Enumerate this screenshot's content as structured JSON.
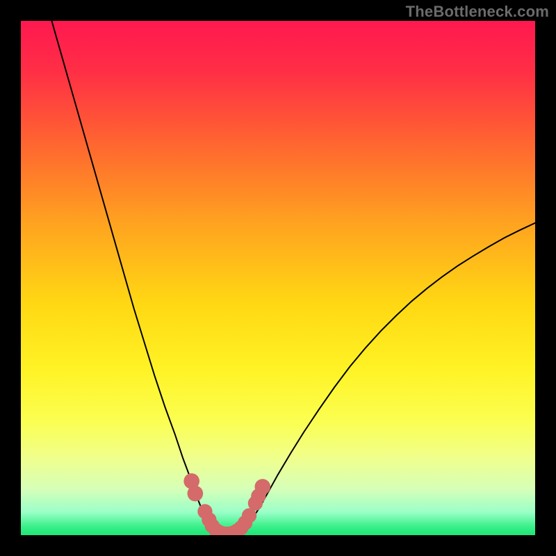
{
  "watermark": "TheBottleneck.com",
  "gradient": {
    "stops": [
      {
        "offset": 0.0,
        "color": "#ff1850"
      },
      {
        "offset": 0.1,
        "color": "#ff2f45"
      },
      {
        "offset": 0.25,
        "color": "#ff6a2f"
      },
      {
        "offset": 0.4,
        "color": "#ffa51f"
      },
      {
        "offset": 0.55,
        "color": "#ffd813"
      },
      {
        "offset": 0.68,
        "color": "#fff326"
      },
      {
        "offset": 0.78,
        "color": "#fbff52"
      },
      {
        "offset": 0.85,
        "color": "#f0ff8c"
      },
      {
        "offset": 0.91,
        "color": "#d6ffb8"
      },
      {
        "offset": 0.955,
        "color": "#9bffc8"
      },
      {
        "offset": 0.985,
        "color": "#35ef86"
      },
      {
        "offset": 1.0,
        "color": "#1fe676"
      }
    ]
  },
  "chart_data": {
    "type": "line",
    "title": "",
    "xlabel": "",
    "ylabel": "",
    "xlim": [
      0,
      100
    ],
    "ylim": [
      0,
      100
    ],
    "series": [
      {
        "name": "left-curve",
        "x": [
          6,
          8,
          10,
          12,
          14,
          16,
          18,
          20,
          22,
          24,
          26,
          28,
          30,
          31.5,
          33,
          34,
          35,
          36,
          36.8,
          37.4
        ],
        "y": [
          100,
          93,
          86,
          79,
          72,
          65,
          58,
          51,
          44,
          37.5,
          31,
          25,
          19.5,
          15,
          11,
          8,
          5.5,
          3.5,
          1.8,
          0.6
        ]
      },
      {
        "name": "valley-floor",
        "x": [
          37.4,
          38.2,
          39.2,
          40.2,
          41.2,
          42.0,
          42.8
        ],
        "y": [
          0.6,
          0.2,
          0.1,
          0.1,
          0.15,
          0.3,
          0.7
        ]
      },
      {
        "name": "right-curve",
        "x": [
          42.8,
          43.8,
          45,
          46.5,
          48,
          50,
          52.5,
          55,
          58,
          61,
          64,
          67,
          70,
          73,
          76,
          79,
          82,
          85,
          88,
          91,
          94,
          97,
          100
        ],
        "y": [
          0.7,
          1.6,
          3.2,
          5.5,
          8.2,
          11.8,
          16,
          20,
          24.5,
          28.8,
          32.8,
          36.4,
          39.7,
          42.7,
          45.5,
          48,
          50.3,
          52.4,
          54.3,
          56.1,
          57.8,
          59.3,
          60.7
        ]
      }
    ],
    "markers": {
      "name": "highlight-dots",
      "color": "#d46a6a",
      "points": [
        {
          "x": 33.2,
          "y": 10.5,
          "r": 1.1
        },
        {
          "x": 33.9,
          "y": 8.1,
          "r": 1.1
        },
        {
          "x": 35.8,
          "y": 4.6,
          "r": 1.0
        },
        {
          "x": 36.6,
          "y": 3.0,
          "r": 1.0
        },
        {
          "x": 37.2,
          "y": 1.8,
          "r": 1.0
        },
        {
          "x": 38.0,
          "y": 0.9,
          "r": 1.0
        },
        {
          "x": 38.8,
          "y": 0.45,
          "r": 1.0
        },
        {
          "x": 39.6,
          "y": 0.25,
          "r": 1.0
        },
        {
          "x": 40.4,
          "y": 0.25,
          "r": 1.0
        },
        {
          "x": 41.2,
          "y": 0.4,
          "r": 1.0
        },
        {
          "x": 42.0,
          "y": 0.8,
          "r": 1.0
        },
        {
          "x": 42.8,
          "y": 1.4,
          "r": 1.0
        },
        {
          "x": 43.6,
          "y": 2.4,
          "r": 1.0
        },
        {
          "x": 44.4,
          "y": 3.8,
          "r": 1.0
        },
        {
          "x": 45.6,
          "y": 6.2,
          "r": 1.0
        },
        {
          "x": 46.2,
          "y": 7.6,
          "r": 1.0
        },
        {
          "x": 47.0,
          "y": 9.4,
          "r": 1.1
        }
      ]
    }
  }
}
